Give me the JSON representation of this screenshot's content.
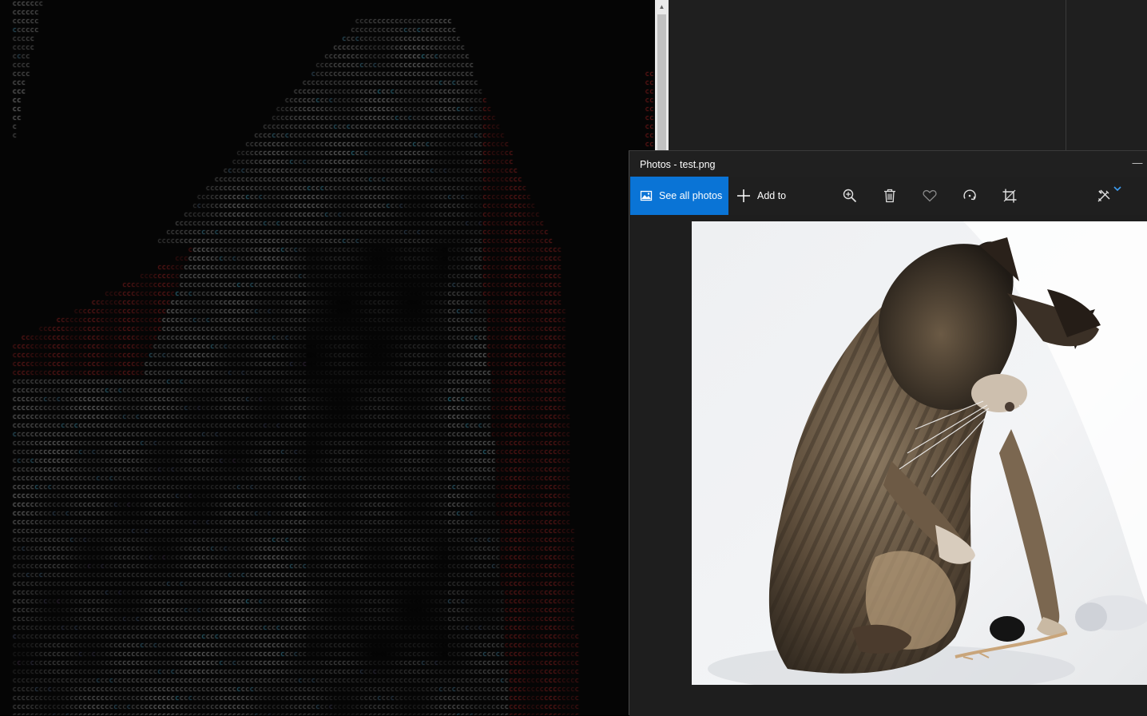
{
  "terminal": {
    "glyph": "c"
  },
  "photos_window": {
    "title": "Photos - test.png",
    "minimize_glyph": "—",
    "toolbar": {
      "see_all_photos_label": "See all photos",
      "add_to_label": "Add to"
    },
    "accent_color": "#0a74d6",
    "image_subject": "tabby cat playing with a toy mouse"
  },
  "icons": {
    "see_all": "photos-icon",
    "add": "plus-icon",
    "zoom": "zoom-in-icon",
    "delete": "trash-icon",
    "favorite": "heart-icon",
    "rotate": "rotate-icon",
    "crop": "crop-icon",
    "edit": "edit-draw-icon",
    "dropdown": "chevron-down-icon"
  }
}
